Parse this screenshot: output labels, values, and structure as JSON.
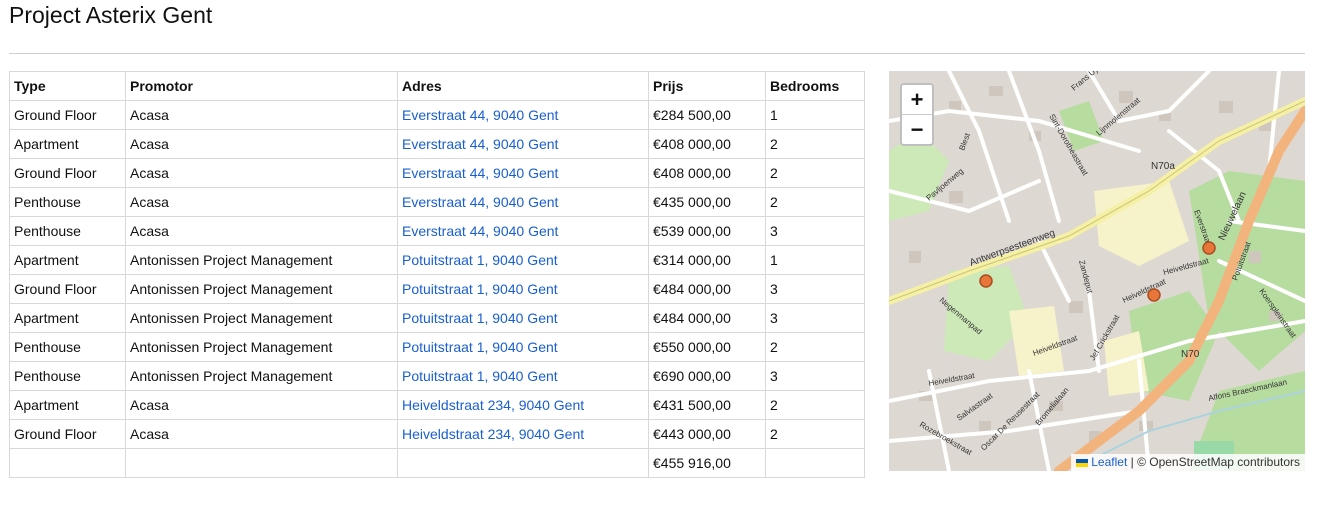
{
  "page": {
    "title": "Project Asterix Gent"
  },
  "table": {
    "headers": [
      "Type",
      "Promotor",
      "Adres",
      "Prijs",
      "Bedrooms"
    ],
    "rows": [
      [
        "Ground Floor",
        "Acasa",
        "Everstraat 44, 9040 Gent",
        "€284 500,00",
        "1"
      ],
      [
        "Apartment",
        "Acasa",
        "Everstraat 44, 9040 Gent",
        "€408 000,00",
        "2"
      ],
      [
        "Ground Floor",
        "Acasa",
        "Everstraat 44, 9040 Gent",
        "€408 000,00",
        "2"
      ],
      [
        "Penthouse",
        "Acasa",
        "Everstraat 44, 9040 Gent",
        "€435 000,00",
        "2"
      ],
      [
        "Penthouse",
        "Acasa",
        "Everstraat 44, 9040 Gent",
        "€539 000,00",
        "3"
      ],
      [
        "Apartment",
        "Antonissen Project Management",
        "Potuitstraat 1, 9040 Gent",
        "€314 000,00",
        "1"
      ],
      [
        "Ground Floor",
        "Antonissen Project Management",
        "Potuitstraat 1, 9040 Gent",
        "€484 000,00",
        "3"
      ],
      [
        "Apartment",
        "Antonissen Project Management",
        "Potuitstraat 1, 9040 Gent",
        "€484 000,00",
        "3"
      ],
      [
        "Penthouse",
        "Antonissen Project Management",
        "Potuitstraat 1, 9040 Gent",
        "€550 000,00",
        "2"
      ],
      [
        "Penthouse",
        "Antonissen Project Management",
        "Potuitstraat 1, 9040 Gent",
        "€690 000,00",
        "3"
      ],
      [
        "Apartment",
        "Acasa",
        "Heiveldstraat 234, 9040 Gent",
        "€431 500,00",
        "2"
      ],
      [
        "Ground Floor",
        "Acasa",
        "Heiveldstraat 234, 9040 Gent",
        "€443 000,00",
        "2"
      ]
    ],
    "footer": [
      "",
      "",
      "",
      "€455 916,00",
      ""
    ]
  },
  "map": {
    "zoom_in_label": "+",
    "zoom_out_label": "−",
    "attribution_link": "Leaflet",
    "attribution_text": "| © OpenStreetMap contributors",
    "marker_color": "#e8763a",
    "street_labels": [
      "Antwerpsesteenweg",
      "N70a",
      "N70",
      "Nieuwelaan",
      "Heiveldstraat",
      "Heiveldstraat",
      "Heiveldstraat",
      "Heiveldstraat",
      "Pavljoenweg",
      "Sint-Dorotheastraat",
      "Lijnmolenstraat",
      "Everstraat",
      "Zandeput",
      "Negenmanpad",
      "Jef Crickstraat",
      "Alfons Braeckmanlaan",
      "Koerspleinstraat",
      "Salviastraat",
      "Rozebroekstraat",
      "Oscar De Reusestraat",
      "Bromelialaan",
      "Blest",
      "Frans Uyt",
      "Potuitstraat"
    ]
  }
}
